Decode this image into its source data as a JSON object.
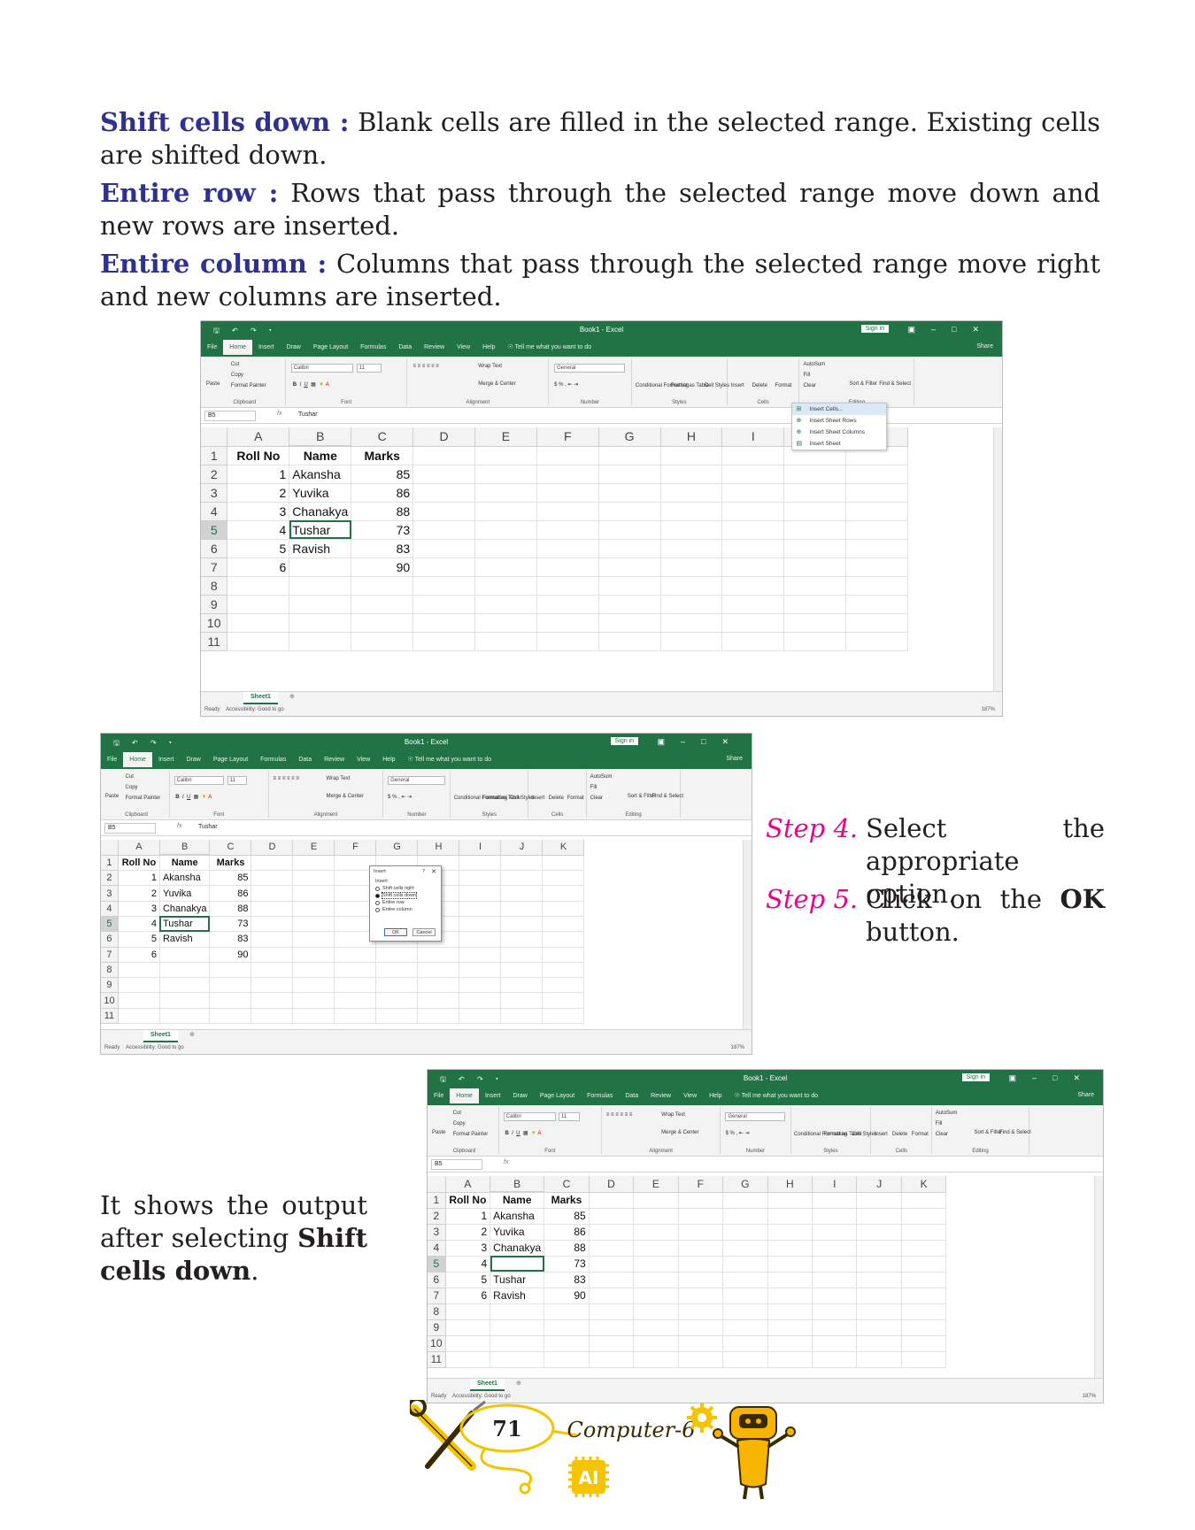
{
  "paragraphs": [
    {
      "term": "Shift cells down :",
      "text": " Blank cells are filled in the selected range. Existing cells are shifted down."
    },
    {
      "term": "Entire row :",
      "text": " Rows that pass through the selected range move down and new rows are inserted."
    },
    {
      "term": "Entire column :",
      "text": " Columns that pass through the selected range move right and new columns are inserted."
    }
  ],
  "excel": {
    "app_title": "Book1 - Excel",
    "sign_in": "Sign in",
    "share": "Share",
    "tabs": [
      "File",
      "Home",
      "Insert",
      "Draw",
      "Page Layout",
      "Formulas",
      "Data",
      "Review",
      "View",
      "Help"
    ],
    "tell_me": "Tell me what you want to do",
    "ribbon": {
      "clipboard": {
        "label": "Clipboard",
        "paste": "Paste",
        "cut": "Cut",
        "copy": "Copy",
        "format_painter": "Format Painter"
      },
      "font": {
        "label": "Font",
        "font_name": "Calibri",
        "font_size": "11"
      },
      "alignment": {
        "label": "Alignment",
        "wrap_text": "Wrap Text",
        "merge_center": "Merge & Center"
      },
      "number": {
        "label": "Number",
        "format": "General"
      },
      "styles": {
        "label": "Styles",
        "conditional": "Conditional Formatting",
        "format_table": "Format as Table",
        "cell_styles": "Cell Styles"
      },
      "cells": {
        "label": "Cells",
        "insert": "Insert",
        "delete": "Delete",
        "format": "Format"
      },
      "editing": {
        "label": "Editing",
        "autosum": "AutoSum",
        "fill": "Fill",
        "clear": "Clear",
        "sort_filter": "Sort & Filter",
        "find_select": "Find & Select"
      }
    },
    "name_box": "B5",
    "fx": "fx",
    "columns": [
      "A",
      "B",
      "C",
      "D",
      "E",
      "F",
      "G",
      "H",
      "I",
      "J",
      "K"
    ],
    "sheet_tab": "Sheet1",
    "status_ready": "Ready",
    "accessibility": "Accessibility: Good to go",
    "zoom": "187%"
  },
  "screens": [
    {
      "formula_value": "Tushar",
      "rows": [
        [
          "Roll No",
          "Name",
          "Marks"
        ],
        [
          "1",
          "Akansha",
          "85"
        ],
        [
          "2",
          "Yuvika",
          "86"
        ],
        [
          "3",
          "Chanakya",
          "88"
        ],
        [
          "4",
          "Tushar",
          "73"
        ],
        [
          "5",
          "Ravish",
          "83"
        ],
        [
          "6",
          "",
          "90"
        ]
      ],
      "insert_menu": [
        "Insert Cells...",
        "Insert Sheet Rows",
        "Insert Sheet Columns",
        "Insert Sheet"
      ]
    },
    {
      "formula_value": "Tushar",
      "rows": [
        [
          "Roll No",
          "Name",
          "Marks"
        ],
        [
          "1",
          "Akansha",
          "85"
        ],
        [
          "2",
          "Yuvika",
          "86"
        ],
        [
          "3",
          "Chanakya",
          "88"
        ],
        [
          "4",
          "Tushar",
          "73"
        ],
        [
          "5",
          "Ravish",
          "83"
        ],
        [
          "6",
          "",
          "90"
        ]
      ],
      "dialog": {
        "title": "Insert",
        "help": "?",
        "group": "Insert",
        "options": [
          "Shift cells right",
          "Shift cells down",
          "Entire row",
          "Entire column"
        ],
        "selected": 1,
        "ok": "OK",
        "cancel": "Cancel"
      }
    },
    {
      "formula_value": "",
      "rows": [
        [
          "Roll No",
          "Name",
          "Marks"
        ],
        [
          "1",
          "Akansha",
          "85"
        ],
        [
          "2",
          "Yuvika",
          "86"
        ],
        [
          "3",
          "Chanakya",
          "88"
        ],
        [
          "4",
          "",
          "73"
        ],
        [
          "5",
          "Tushar",
          "83"
        ],
        [
          "6",
          "Ravish",
          "90"
        ]
      ]
    }
  ],
  "steps": [
    {
      "label": "Step 4.",
      "text": "Select the appropriate option."
    },
    {
      "label": "Step 5.",
      "text_before": "Click on the ",
      "bold": "OK",
      "text_after": " button."
    }
  ],
  "output_note": {
    "text_before": "It shows the output after selecting ",
    "bold": "Shift cells down",
    "text_after": "."
  },
  "footer": {
    "page_number": "71",
    "book_title": "Computer-6",
    "ai_badge": "AI",
    "brand_colors": {
      "yellow": "#f5c400",
      "dark": "#3a2a00",
      "robot": "#f7b500"
    }
  }
}
